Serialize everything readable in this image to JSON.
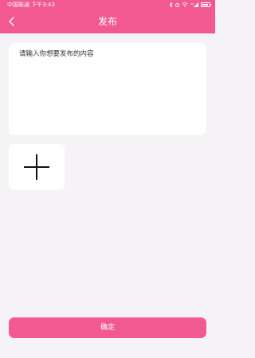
{
  "status_bar": {
    "carrier_time": "中国联通 下午3:43",
    "network_label": "4G",
    "icons": [
      "bluetooth-icon",
      "alarm-icon",
      "wifi-icon",
      "signal-icon",
      "battery-icon"
    ]
  },
  "header": {
    "title": "发布",
    "back_icon": "chevron-left-icon",
    "background": "#f25a8f"
  },
  "form": {
    "content_placeholder": "请输入你想要发布的内容",
    "content_value": "",
    "add_image_icon": "plus-icon"
  },
  "footer": {
    "confirm_label": "确定"
  },
  "colors": {
    "accent": "#f25a8f",
    "background": "#f5f3f5",
    "card": "#ffffff"
  }
}
